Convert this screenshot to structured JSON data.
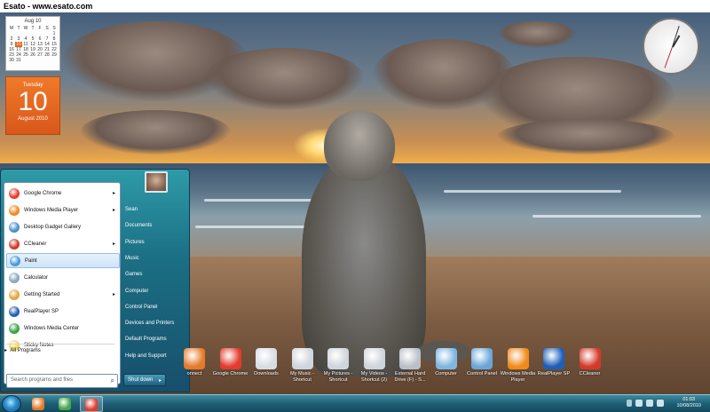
{
  "window": {
    "title": "Esato - www.esato.com"
  },
  "calendar": {
    "month_header": "Aug 10",
    "weekdays": [
      "M",
      "T",
      "W",
      "T",
      "F",
      "S",
      "S"
    ],
    "weeks": [
      [
        "",
        "",
        "",
        "",
        "",
        "",
        "1"
      ],
      [
        "2",
        "3",
        "4",
        "5",
        "6",
        "7",
        "8"
      ],
      [
        "9",
        "10",
        "11",
        "12",
        "13",
        "14",
        "15"
      ],
      [
        "16",
        "17",
        "18",
        "19",
        "20",
        "21",
        "22"
      ],
      [
        "23",
        "24",
        "25",
        "26",
        "27",
        "28",
        "29"
      ],
      [
        "30",
        "31",
        "",
        "",
        "",
        "",
        ""
      ]
    ],
    "today": "10",
    "weekday": "Tuesday",
    "day": "10",
    "month_year": "August 2010"
  },
  "start_menu": {
    "programs": [
      {
        "label": "Google Chrome",
        "icon": "chrome-icon",
        "color": "#e33b2e",
        "has_arrow": true
      },
      {
        "label": "Windows Media Player",
        "icon": "media-player-icon",
        "color": "#f08a1c",
        "has_arrow": true
      },
      {
        "label": "Desktop Gadget Gallery",
        "icon": "gadget-gallery-icon",
        "color": "#4a90c8",
        "has_arrow": false
      },
      {
        "label": "CCleaner",
        "icon": "ccleaner-icon",
        "color": "#d33a2a",
        "has_arrow": true
      },
      {
        "label": "Paint",
        "icon": "paint-icon",
        "color": "#4a9ad8",
        "has_arrow": false,
        "highlighted": true
      },
      {
        "label": "Calculator",
        "icon": "calculator-icon",
        "color": "#8aa6c0",
        "has_arrow": false
      },
      {
        "label": "Getting Started",
        "icon": "getting-started-icon",
        "color": "#e6a43a",
        "has_arrow": true
      },
      {
        "label": "RealPlayer SP",
        "icon": "realplayer-icon",
        "color": "#1f5fb8",
        "has_arrow": false
      },
      {
        "label": "Windows Media Center",
        "icon": "media-center-icon",
        "color": "#3aa344",
        "has_arrow": false
      },
      {
        "label": "Sticky Notes",
        "icon": "sticky-notes-icon",
        "color": "#f2d65a",
        "has_arrow": false
      }
    ],
    "all_programs": "All Programs",
    "search_placeholder": "Search programs and files",
    "right_links": [
      "Sean",
      "Documents",
      "Pictures",
      "Music",
      "Games",
      "Computer",
      "Control Panel",
      "Devices and Printers",
      "Default Programs",
      "Help and Support"
    ],
    "shutdown": "Shut down",
    "shutdown_arrow": "▸"
  },
  "desktop_icons": [
    {
      "label": "onnect",
      "icon": "connect-icon",
      "color": "#e57a2a"
    },
    {
      "label": "Google Chrome",
      "icon": "chrome-icon",
      "color": "#e33b2e"
    },
    {
      "label": "Downloads",
      "icon": "downloads-icon",
      "color": "#d7dde5"
    },
    {
      "label": "My Music - Shortcut",
      "icon": "music-shortcut-icon",
      "color": "#cfd5dc"
    },
    {
      "label": "My Pictures - Shortcut",
      "icon": "pictures-shortcut-icon",
      "color": "#cfd5dc"
    },
    {
      "label": "My Videos - Shortcut (2)",
      "icon": "videos-shortcut-icon",
      "color": "#cfd5dc"
    },
    {
      "label": "External Hard Drive (F) - S...",
      "icon": "external-drive-icon",
      "color": "#b9c0c8"
    },
    {
      "label": "Computer",
      "icon": "computer-icon",
      "color": "#7fb6e0"
    },
    {
      "label": "Control Panel",
      "icon": "control-panel-icon",
      "color": "#6aa7d8"
    },
    {
      "label": "Windows Media Player",
      "icon": "media-player-icon",
      "color": "#f08a1c"
    },
    {
      "label": "RealPlayer SP",
      "icon": "realplayer-icon",
      "color": "#1f5fb8"
    },
    {
      "label": "CCleaner",
      "icon": "ccleaner-icon",
      "color": "#d33a2a"
    }
  ],
  "taskbar": {
    "pinned": [
      {
        "icon": "connect-icon",
        "color": "#e57a2a"
      },
      {
        "icon": "gadget-gallery-icon",
        "color": "#46a64a"
      },
      {
        "icon": "chrome-icon",
        "color": "#e33b2e",
        "active": true
      }
    ],
    "time": "01:03",
    "date": "10/08/2010"
  }
}
